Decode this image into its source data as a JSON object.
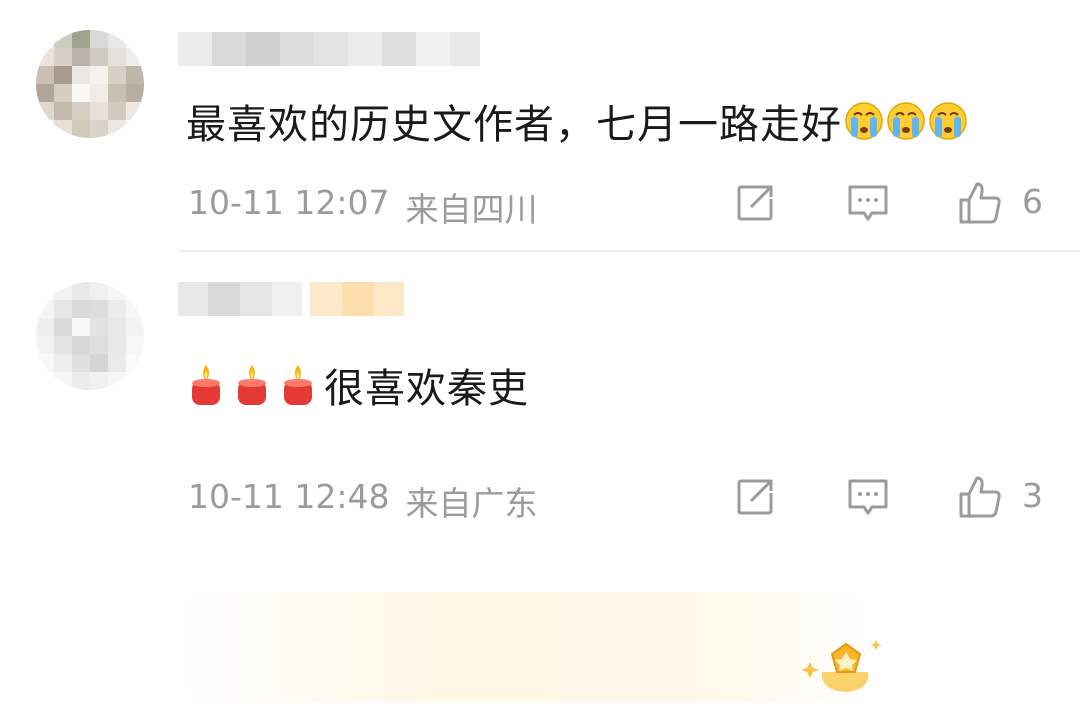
{
  "comments": [
    {
      "text": "最喜欢的历史文作者，七月一路走好",
      "emoji_count": 3,
      "emoji": "crying-face-icon",
      "date": "10-11 12:07",
      "location": "来自四川",
      "likes": "6"
    },
    {
      "text": "很喜欢秦吏",
      "candle_count": 3,
      "emoji": "candle-icon",
      "date": "10-11 12:48",
      "location": "来自广东",
      "likes": "3"
    }
  ],
  "colors": {
    "text": "#1a1a1a",
    "meta": "#9b9b9b",
    "divider": "#efefef",
    "badge": "#f7b52c"
  }
}
